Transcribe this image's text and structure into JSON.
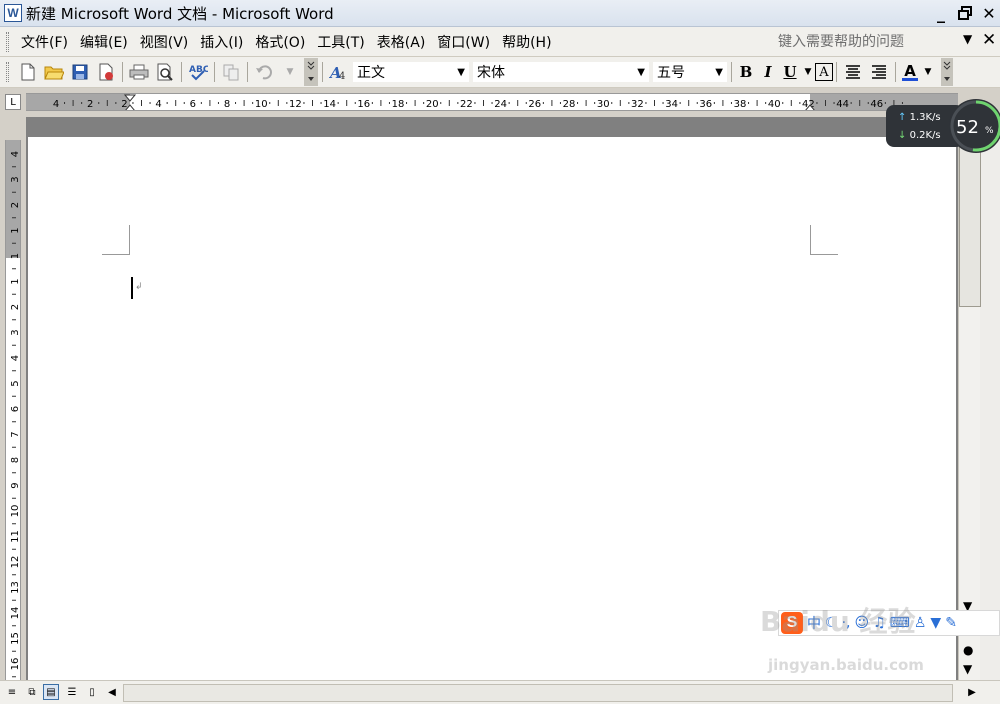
{
  "window": {
    "title": "新建 Microsoft Word 文档 - Microsoft Word",
    "icon": "word-icon",
    "controls": [
      "minimize-icon",
      "restore-icon",
      "close-icon"
    ]
  },
  "menubar": {
    "items": [
      "文件(F)",
      "编辑(E)",
      "视图(V)",
      "插入(I)",
      "格式(O)",
      "工具(T)",
      "表格(A)",
      "窗口(W)",
      "帮助(H)"
    ],
    "help_placeholder": "键入需要帮助的问题",
    "close_doc": "✕"
  },
  "toolbar": {
    "style_value": "正文",
    "font_value": "宋体",
    "size_value": "五号",
    "bold": "B",
    "italic": "I",
    "underline": "U",
    "boxed": "A",
    "font_color": "A"
  },
  "ruler": {
    "h_ticks": [
      "4",
      "2",
      "2",
      "4",
      "6",
      "8",
      "10",
      "12",
      "14",
      "16",
      "18",
      "20",
      "22",
      "24",
      "26",
      "28",
      "30",
      "32",
      "34",
      "36",
      "38",
      "40",
      "42",
      "44",
      "46"
    ],
    "v_ticks_top": [
      "4",
      "3",
      "2",
      "1"
    ],
    "v_ticks": [
      "1",
      "1",
      "2",
      "3",
      "4",
      "5",
      "6",
      "7",
      "8",
      "9",
      "10",
      "11",
      "12",
      "13",
      "14",
      "15",
      "16"
    ],
    "corner_label": "L"
  },
  "net_speed": {
    "upload": "1.3K/s",
    "download": "0.2K/s",
    "percent_value": "52",
    "percent_sign": "%",
    "percent": 52
  },
  "ime": {
    "logo": "S",
    "mode": "中",
    "icons": [
      "moon-icon",
      "punctuation-icon",
      "emoji-icon",
      "mic-icon",
      "keyboard-icon",
      "user-icon",
      "shirt-icon",
      "wrench-icon"
    ]
  },
  "watermark": {
    "text": "Baidu 经验",
    "url": "jingyan.baidu.com"
  },
  "colors": {
    "doc_background": "#808080",
    "page": "#ffffff",
    "ime_orange": "#ff5e1a"
  }
}
